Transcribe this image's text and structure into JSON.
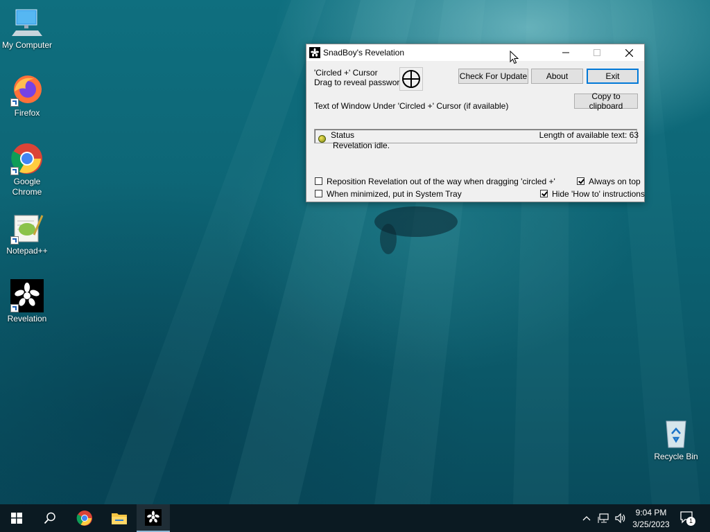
{
  "desktop": {
    "icons": [
      {
        "label": "My Computer"
      },
      {
        "label": "Firefox"
      },
      {
        "label": "Google Chrome"
      },
      {
        "label": "Notepad++"
      },
      {
        "label": "Revelation"
      },
      {
        "label": "Recycle Bin"
      }
    ]
  },
  "window": {
    "title": "SnadBoy's Revelation",
    "cursor_label": "'Circled +' Cursor",
    "drag_label": "Drag to reveal password",
    "check_update_label": "Check For Update",
    "about_label": "About",
    "exit_label": "Exit",
    "copy_label": "Copy to clipboard",
    "text_under_label": "Text of Window Under 'Circled +' Cursor (if available)",
    "text_value": "",
    "status_label": "Status",
    "status_text": "Revelation idle.",
    "length_label": "Length of available text: 63",
    "reposition_label": "Reposition Revelation out of the way when dragging 'circled +'",
    "always_on_top_label": "Always on top",
    "minimized_label": "When minimized, put in System Tray",
    "hide_howto_label": "Hide 'How to' instructions",
    "checkboxes": {
      "reposition": false,
      "always_on_top": true,
      "minimized_tray": false,
      "hide_howto": true
    }
  },
  "taskbar": {
    "time": "9:04 PM",
    "date": "3/25/2023",
    "notifications": "1"
  },
  "colors": {
    "accent": "#0078d7",
    "taskbar": "#0b1a22"
  }
}
